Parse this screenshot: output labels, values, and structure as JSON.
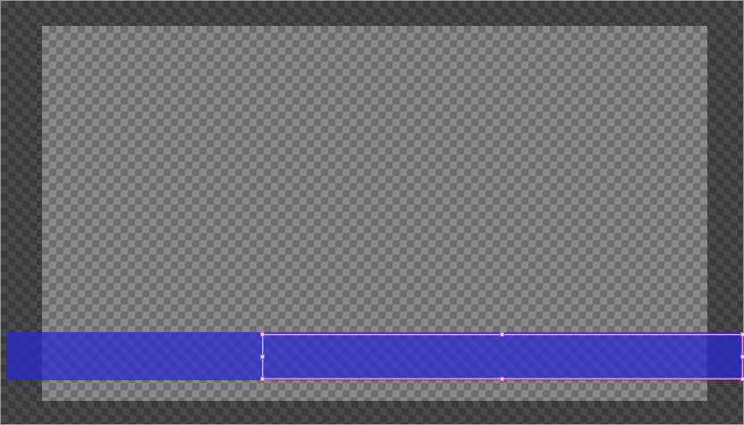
{
  "canvas": {
    "background": "transparency-checkerboard",
    "colors": {
      "outer_checker_dark": "#3a3a3a",
      "outer_checker_light": "#4a4a4a",
      "inner_checker_dark": "#6e6e6e",
      "inner_checker_light": "#8a8a8a"
    }
  },
  "layers": [
    {
      "name": "lower-third-bar",
      "fill_color": "#2828d7",
      "opacity": 0.72,
      "selected": false
    },
    {
      "name": "selected-layer",
      "selection_color": "#e8a6ff",
      "selected": true,
      "handles": [
        "top-left",
        "top-middle",
        "top-right",
        "middle-left",
        "middle-right",
        "bottom-left",
        "bottom-middle",
        "bottom-right"
      ]
    }
  ]
}
